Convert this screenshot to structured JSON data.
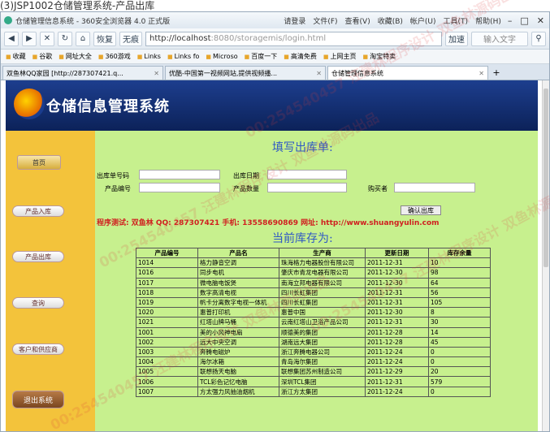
{
  "caption": "(3)JSP1002仓储管理系统-产品出库",
  "browser": {
    "window_title": "仓储管理信息系统 - 360安全浏览器 4.0 正式版",
    "login_label": "请登录",
    "menus": [
      "文件(F)",
      "查看(V)",
      "收藏(B)",
      "帐户(U)",
      "工具(T)",
      "帮助(H)"
    ],
    "nav": {
      "back": "◀",
      "forward": "▶",
      "stop": "✕",
      "refresh": "↻",
      "home": "⌂",
      "restore": "恢复",
      "no_ad": "无痕"
    },
    "url_host": "http://localhost",
    "url_rest": ":8080/storagemis/login.html",
    "accelerate": "加速",
    "search_placeholder": "输入文字",
    "bookmarks": [
      "收藏",
      "谷歌",
      "网址大全",
      "360游戏",
      "Links",
      "Links fo",
      "Microso",
      "百度一下",
      "高清免费",
      "上网主页",
      "淘宝特卖"
    ],
    "tabs": [
      {
        "label": "双鱼林QQ家园 [http://287307421.q..."
      },
      {
        "label": "优酷-中国第一视频网站,提供视频播..."
      },
      {
        "label": "仓储管理信息系统"
      }
    ]
  },
  "page": {
    "system_name": "仓储信息管理系统",
    "sidebar": {
      "home": "首页",
      "items": [
        "产品入库",
        "产品出库",
        "查询",
        "客户和供应商"
      ],
      "exit": "退出系统"
    },
    "form_title": "填写出库单:",
    "labels": {
      "order_no": "出库单号码",
      "out_date": "出库日期",
      "product_no": "产品编号",
      "quantity": "产品数量",
      "buyer": "购买者"
    },
    "submit_label": "确认出库",
    "promo": "程序测试: 双鱼林  QQ: 287307421  手机: 13558690869  网址: http://www.shuangyulin.com",
    "stock_title": "当前库存为:",
    "table": {
      "headers": [
        "产品编号",
        "产品名",
        "生产商",
        "更新日期",
        "库存余量"
      ],
      "rows": [
        [
          "1014",
          "格力静音空调",
          "珠海格力电器股份有限公司",
          "2011-12-31",
          "10"
        ],
        [
          "1016",
          "同步电机",
          "肇庆市青龙电器有限公司",
          "2011-12-30",
          "98"
        ],
        [
          "1017",
          "微电脑电饭煲",
          "南海立邦电器有限公司",
          "2011-12-30",
          "64"
        ],
        [
          "1018",
          "数字高清电视",
          "四川长虹集团",
          "2011-12-31",
          "56"
        ],
        [
          "1019",
          "帆卡分离数字电视一体机",
          "四川长虹集团",
          "2011-12-31",
          "105"
        ],
        [
          "1020",
          "惠普打印机",
          "惠普中国",
          "2011-12-30",
          "8"
        ],
        [
          "1021",
          "红塔山牌马桶",
          "云南红塔山卫浴产品公司",
          "2011-12-31",
          "30"
        ],
        [
          "1001",
          "美的小风神电扇",
          "顺德美的集团",
          "2011-12-28",
          "14"
        ],
        [
          "1002",
          "远大中央空调",
          "湖南远大集团",
          "2011-12-28",
          "45"
        ],
        [
          "1003",
          "奔腾电磁炉",
          "浙江奔腾电器公司",
          "2011-12-24",
          "0"
        ],
        [
          "1004",
          "海尔冰箱",
          "青岛海尔集团",
          "2011-12-24",
          "0"
        ],
        [
          "1005",
          "联想扬天电脑",
          "联想集团苏州制造公司",
          "2011-12-29",
          "20"
        ],
        [
          "1006",
          "TCL彩色记忆电脑",
          "深圳TCL集团",
          "2011-12-31",
          "579"
        ],
        [
          "1007",
          "方太强力风抽油烟机",
          "浙江方太集团",
          "2011-12-24",
          "0"
        ]
      ]
    },
    "watermark": "00:254540457 汪建林程序设计 双鱼林源码出品"
  },
  "colors": {
    "main_bg": "#c7f08e",
    "sidebar_bg": "#f3c33b",
    "header_bg": "#1a3a88",
    "title_blue": "#2f58c5",
    "promo_red": "#d02020"
  }
}
